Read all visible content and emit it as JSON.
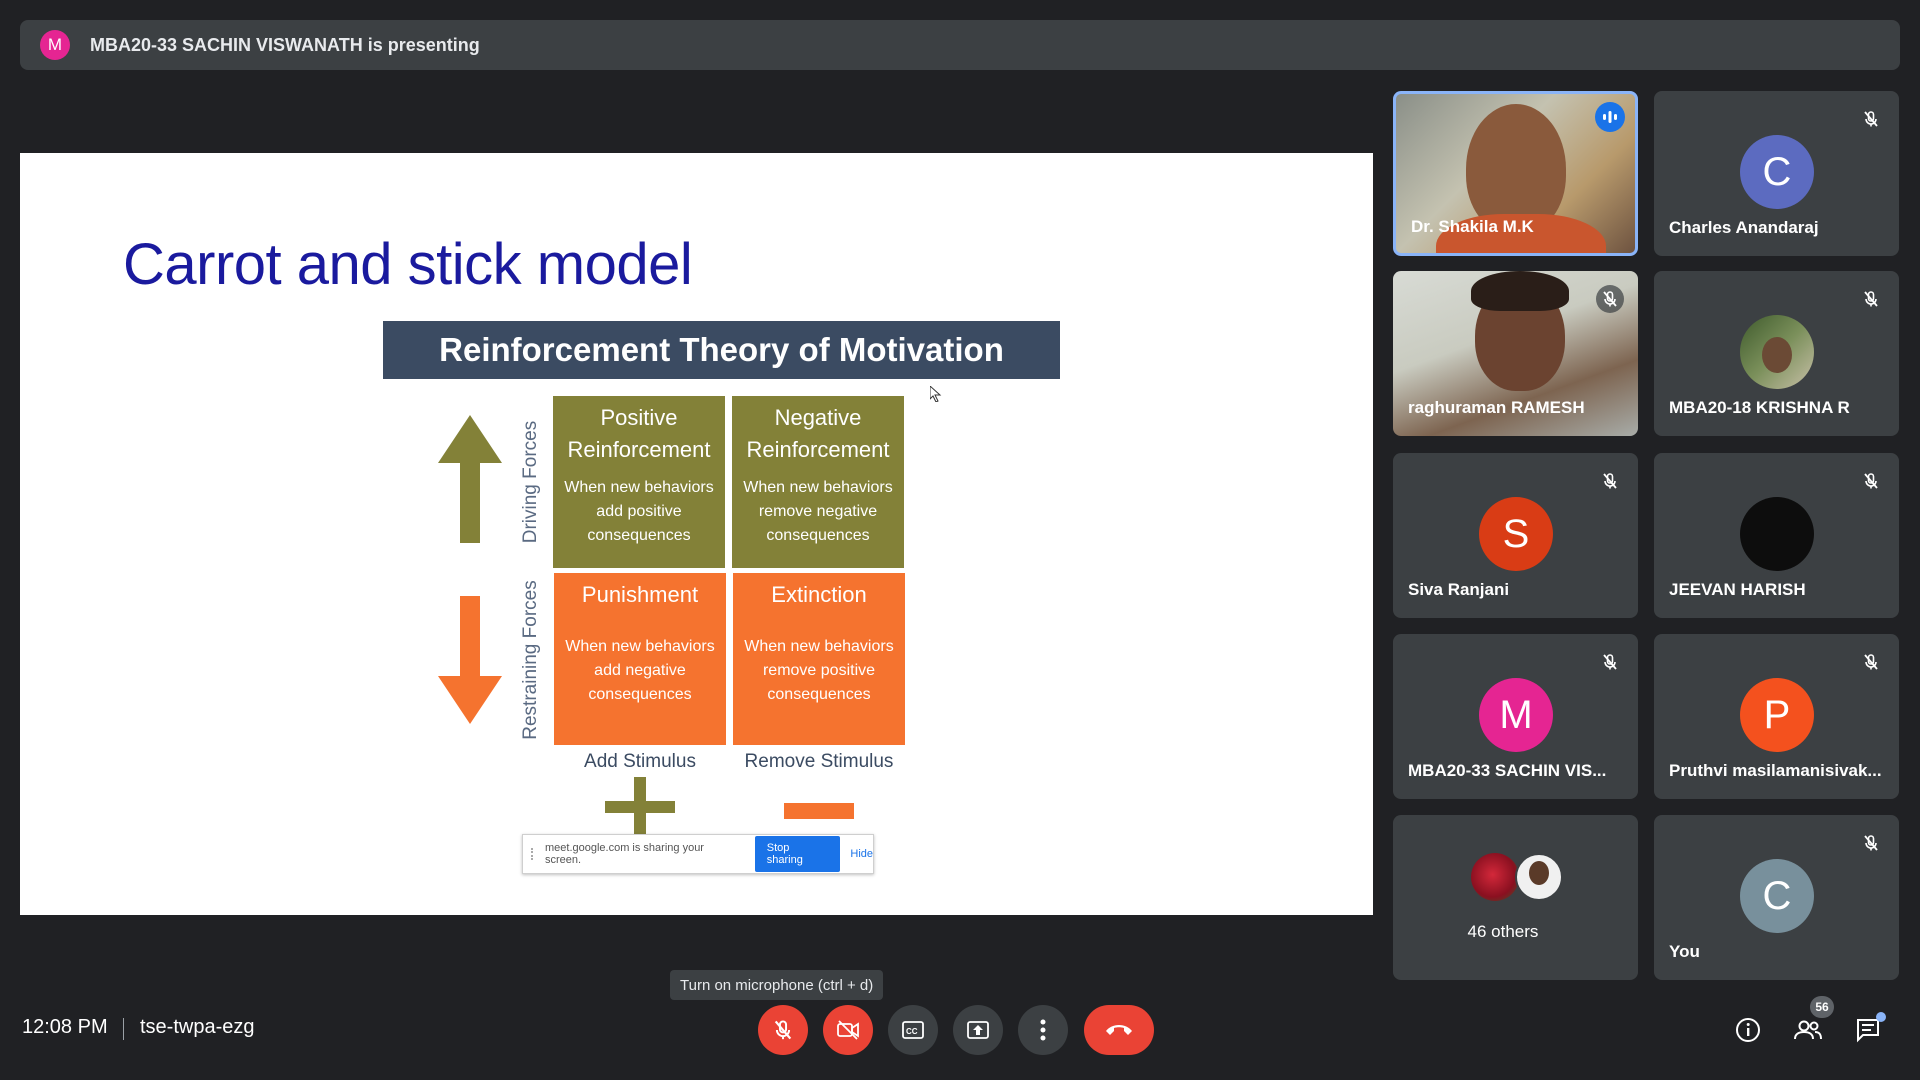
{
  "banner": {
    "avatar_letter": "M",
    "text": "MBA20-33 SACHIN VISWANATH is presenting"
  },
  "slide": {
    "title": "Carrot and stick model",
    "header": "Reinforcement Theory of Motivation",
    "driving_label": "Driving Forces",
    "restraining_label": "Restraining Forces",
    "q1": {
      "title": "Positive Reinforcement",
      "desc": "When new behaviors add positive consequences"
    },
    "q2": {
      "title": "Negative Reinforcement",
      "desc": "When new behaviors remove negative consequences"
    },
    "q3": {
      "title": "Punishment",
      "desc": "When new behaviors add negative consequences"
    },
    "q4": {
      "title": "Extinction",
      "desc": "When new behaviors remove positive consequences"
    },
    "add_stimulus": "Add Stimulus",
    "remove_stimulus": "Remove Stimulus",
    "colors": {
      "olive": "#838138",
      "orange": "#f5732f",
      "title_blue": "#1a1a9e"
    }
  },
  "share_bar": {
    "message": "meet.google.com is sharing your screen.",
    "stop": "Stop sharing",
    "hide": "Hide"
  },
  "participants": [
    {
      "name": "Dr. Shakila M.K",
      "status": "speaking"
    },
    {
      "name": "Charles Anandaraj",
      "letter": "C",
      "color": "#5c6bc0",
      "status": "muted"
    },
    {
      "name": "raghuraman RAMESH",
      "status": "muted"
    },
    {
      "name": "MBA20-18 KRISHNA R",
      "status": "muted"
    },
    {
      "name": "Siva Ranjani",
      "letter": "S",
      "color": "#d93c15",
      "status": "muted"
    },
    {
      "name": "JEEVAN HARISH",
      "status": "muted"
    },
    {
      "name": "MBA20-33 SACHIN VIS...",
      "letter": "M",
      "color": "#e52592",
      "status": "muted"
    },
    {
      "name": "Pruthvi masilamanisivak...",
      "letter": "P",
      "color": "#f4511e",
      "status": "muted"
    },
    {
      "name": "46 others"
    },
    {
      "name": "You",
      "letter": "C",
      "color": "#78909c",
      "status": "muted"
    }
  ],
  "bottom": {
    "time": "12:08 PM",
    "meeting_code": "tse-twpa-ezg",
    "tooltip": "Turn on microphone (ctrl + d)",
    "participant_count": "56"
  }
}
